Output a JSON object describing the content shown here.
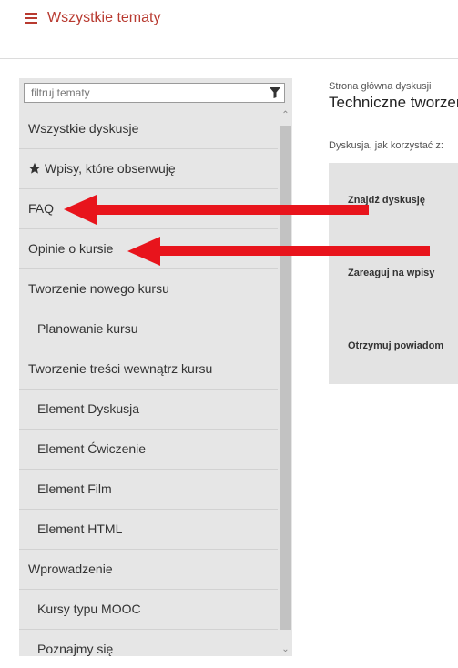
{
  "header": {
    "title": "Wszystkie tematy",
    "accent": "#b83a30"
  },
  "sidebar": {
    "filter_placeholder": "filtruj tematy",
    "items": [
      {
        "label": "Wszystkie dyskusje",
        "level": 0
      },
      {
        "label": "Wpisy, które obserwuję",
        "level": 0,
        "icon": "star-icon"
      },
      {
        "label": "FAQ",
        "level": 0
      },
      {
        "label": "Opinie o kursie",
        "level": 0
      },
      {
        "label": "Tworzenie nowego kursu",
        "level": 0
      },
      {
        "label": "Planowanie kursu",
        "level": 1
      },
      {
        "label": "Tworzenie treści wewnątrz kursu",
        "level": 0
      },
      {
        "label": "Element Dyskusja",
        "level": 1
      },
      {
        "label": "Element Ćwiczenie",
        "level": 1
      },
      {
        "label": "Element Film",
        "level": 1
      },
      {
        "label": "Element HTML",
        "level": 1
      },
      {
        "label": "Wprowadzenie",
        "level": 0
      },
      {
        "label": "Kursy typu MOOC",
        "level": 1
      },
      {
        "label": "Poznajmy się",
        "level": 1
      }
    ]
  },
  "main": {
    "breadcrumb": "Strona główna dyskusji",
    "title": "Techniczne tworzen",
    "howto_label": "Dyskusja, jak korzystać z:",
    "howto_items": [
      "Znajdź dyskusję",
      "Zareaguj na wpisy",
      "Otrzymuj powiadom"
    ]
  },
  "annotations": {
    "arrow_color": "#e8141c"
  }
}
